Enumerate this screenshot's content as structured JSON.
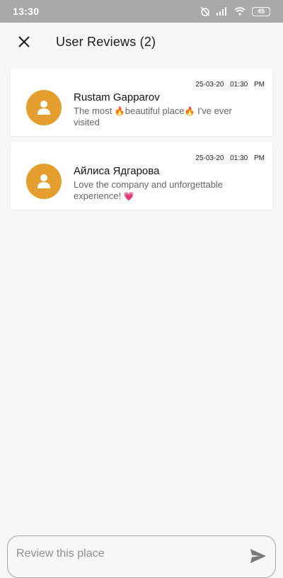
{
  "status_bar": {
    "time": "13:30",
    "battery": "45"
  },
  "header": {
    "title": "User Reviews (2)"
  },
  "reviews": [
    {
      "date": "25-03-20 01:30 PM",
      "name": "Rustam Gapparov",
      "text_before": "The most ",
      "emoji_1": "🔥",
      "text_middle": "beautiful place",
      "emoji_2": "🔥",
      "text_after": " I've ever visited"
    },
    {
      "date": "25-03-20 01:30 PM",
      "name": "Айлиса Ядгарова",
      "text": "Love the company and unforgettable experience! ",
      "emoji": "💗"
    }
  ],
  "input": {
    "placeholder": "Review this place"
  },
  "colors": {
    "accent": "#e39e2d",
    "status_bar": "#a9a9a9"
  },
  "icons": [
    "alarm-off-icon",
    "signal-icon",
    "wifi-icon",
    "battery-icon",
    "close-icon",
    "user-icon",
    "send-icon"
  ]
}
